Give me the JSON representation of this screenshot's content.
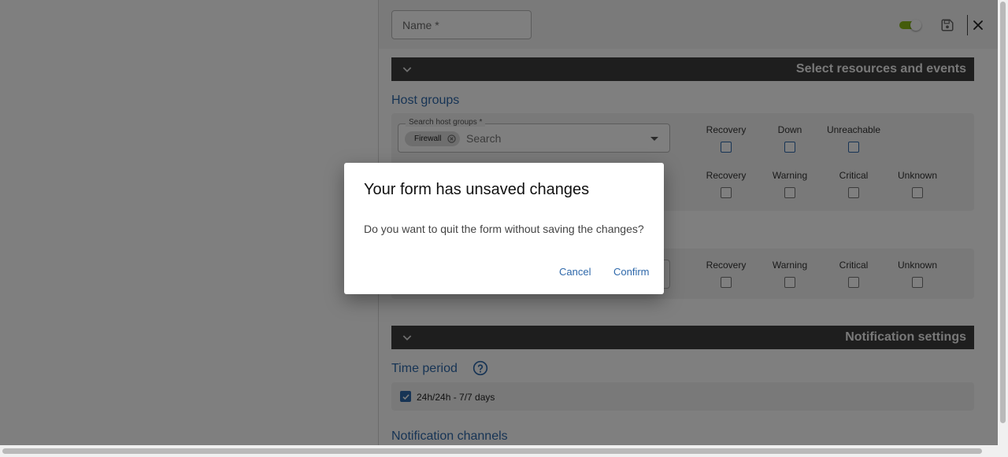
{
  "header": {
    "name_placeholder": "Name *",
    "toggle_state": "on",
    "toggle_color": "#88b917",
    "save_icon": "save-icon",
    "close_icon": "close-icon"
  },
  "sections": {
    "resources_title": "Select resources and events",
    "notification_title": "Notification settings"
  },
  "host_groups": {
    "title": "Host groups",
    "search_label": "Search host groups *",
    "search_placeholder": "Search",
    "selected_chip": "Firewall",
    "host_events": [
      {
        "label": "Recovery",
        "checked": false
      },
      {
        "label": "Down",
        "checked": false
      },
      {
        "label": "Unreachable",
        "checked": false
      }
    ],
    "service_events": [
      {
        "label": "Recovery",
        "checked": false
      },
      {
        "label": "Warning",
        "checked": false
      },
      {
        "label": "Critical",
        "checked": false
      },
      {
        "label": "Unknown",
        "checked": false
      }
    ]
  },
  "second_group": {
    "events": [
      {
        "label": "Recovery",
        "checked": false
      },
      {
        "label": "Warning",
        "checked": false
      },
      {
        "label": "Critical",
        "checked": false
      },
      {
        "label": "Unknown",
        "checked": false
      }
    ]
  },
  "time_period": {
    "title": "Time period",
    "option_label": "24h/24h - 7/7 days",
    "option_checked": true
  },
  "notification_channels": {
    "title": "Notification channels"
  },
  "dialog": {
    "title": "Your form has unsaved changes",
    "message": "Do you want to quit the form without saving the changes?",
    "cancel_label": "Cancel",
    "confirm_label": "Confirm"
  },
  "colors": {
    "accent": "#2e68aa",
    "section_bar": "#3d3d3d",
    "overlay": "rgba(0,0,0,0.5)"
  }
}
